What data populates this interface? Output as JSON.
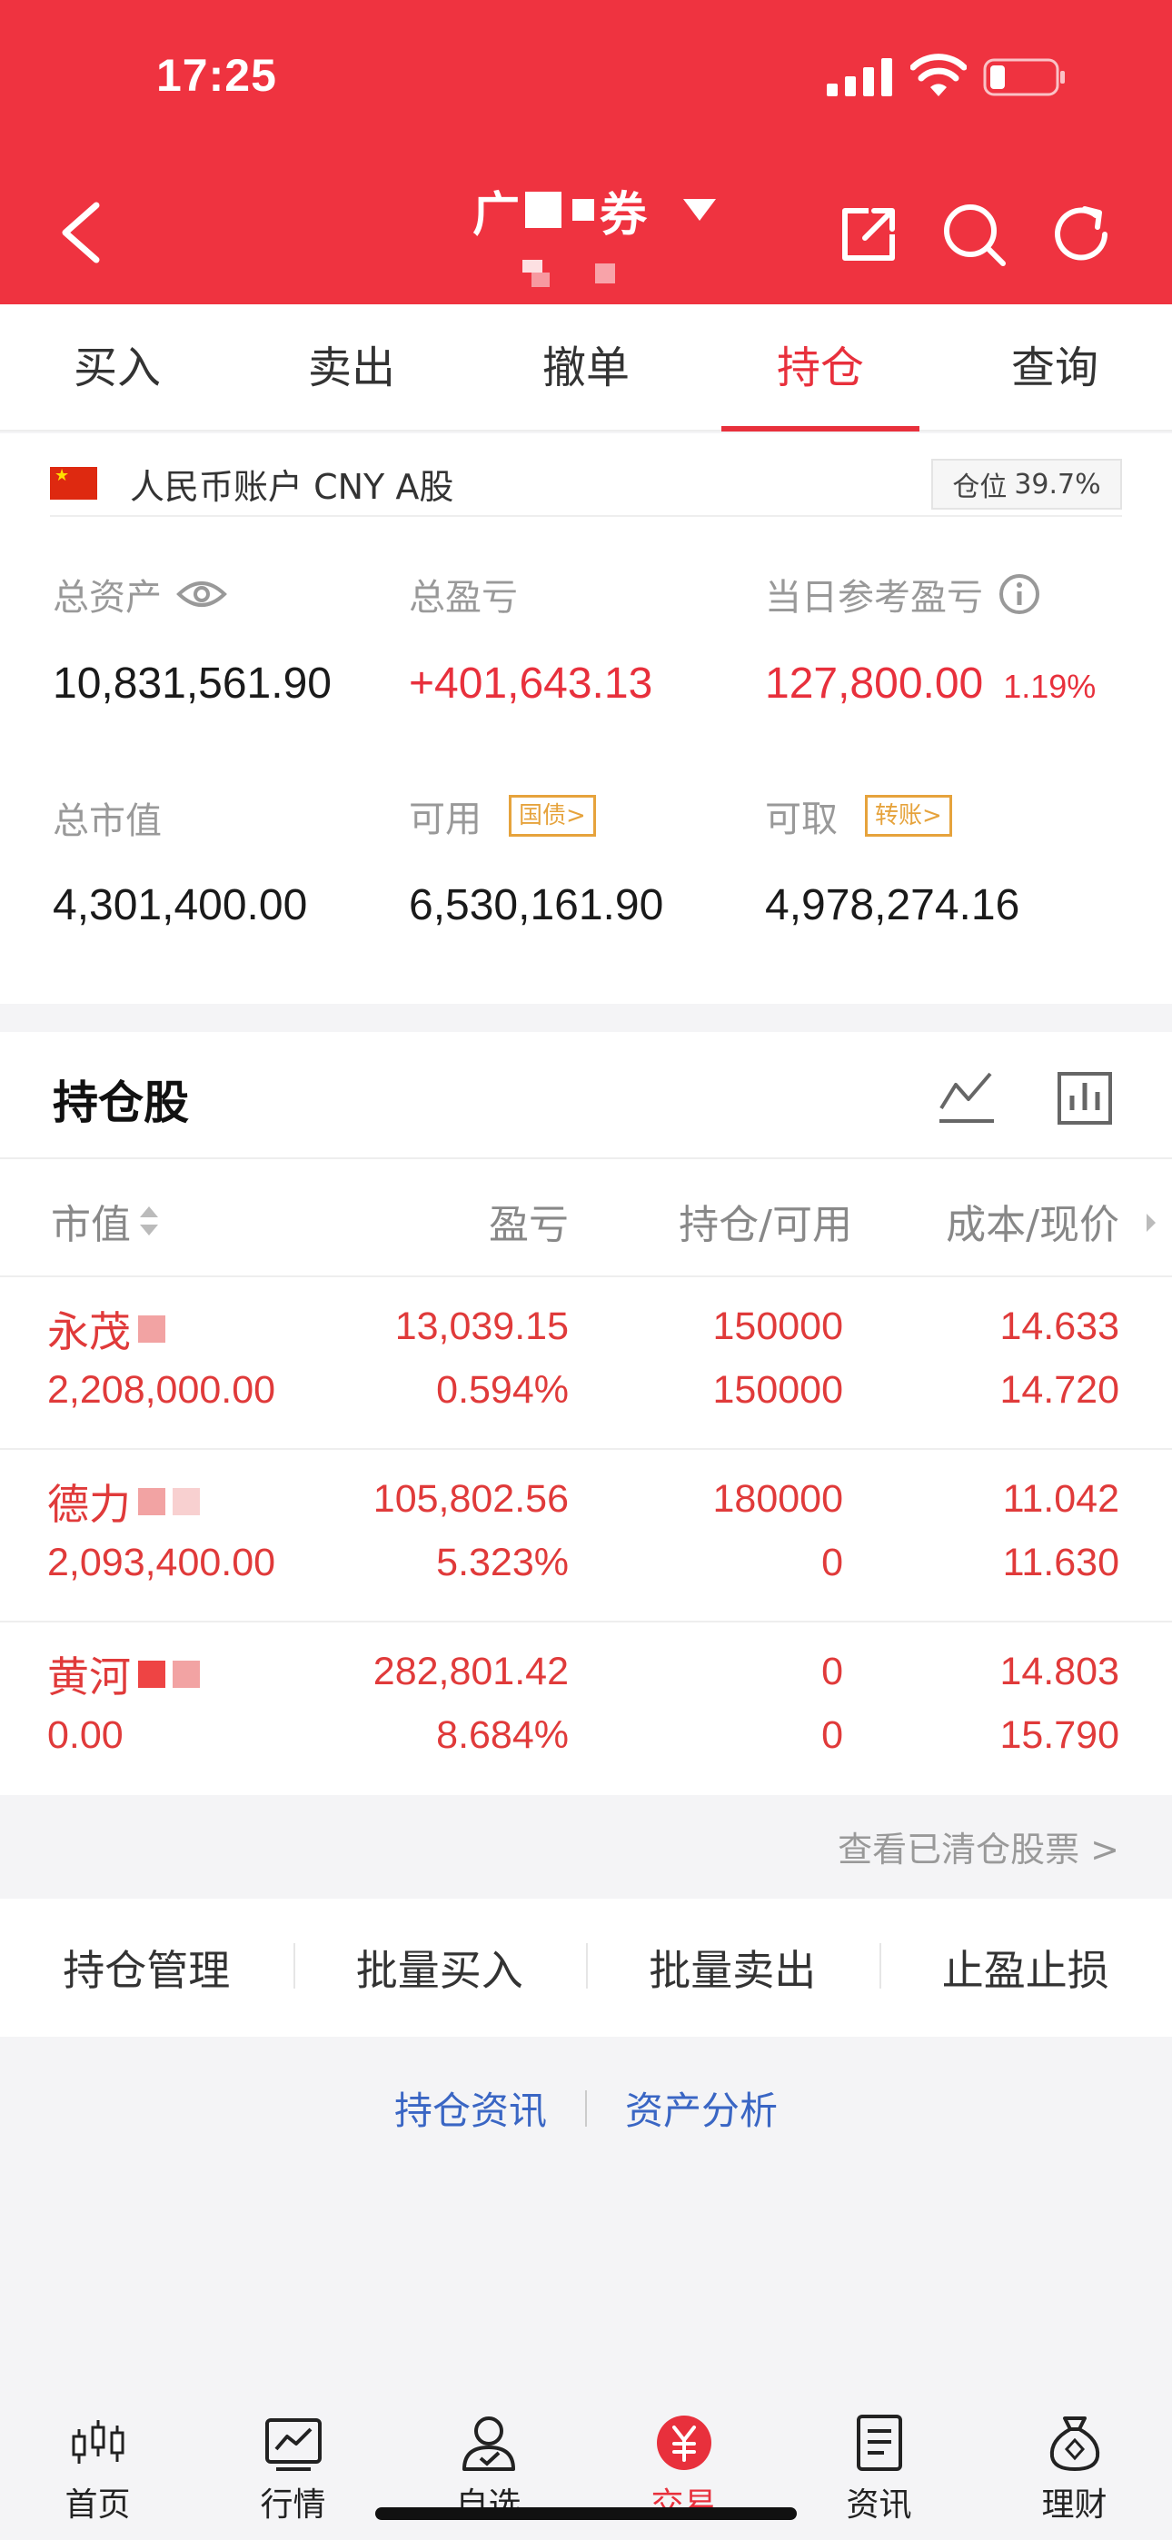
{
  "status_bar": {
    "time": "17:25"
  },
  "header": {
    "title_prefix": "广",
    "title_suffix": "券"
  },
  "tabs": [
    {
      "label": "买入"
    },
    {
      "label": "卖出"
    },
    {
      "label": "撤单"
    },
    {
      "label": "持仓",
      "active": true
    },
    {
      "label": "查询"
    }
  ],
  "account": {
    "name": "人民币账户 CNY A股",
    "position_label": "仓位",
    "position_value": "39.7%",
    "total_assets_label": "总资产",
    "total_assets": "10,831,561.90",
    "total_pl_label": "总盈亏",
    "total_pl": "+401,643.13",
    "daily_pl_label": "当日参考盈亏",
    "daily_pl": "127,800.00",
    "daily_pl_pct": "1.19%",
    "market_value_label": "总市值",
    "market_value": "4,301,400.00",
    "available_label": "可用",
    "available_tag": "国债>",
    "available": "6,530,161.90",
    "withdrawable_label": "可取",
    "withdrawable_tag": "转账>",
    "withdrawable": "4,978,274.16"
  },
  "holdings": {
    "title": "持仓股",
    "columns": {
      "market_value": "市值",
      "pl": "盈亏",
      "qty": "持仓/可用",
      "price": "成本/现价"
    },
    "rows": [
      {
        "name": "永茂",
        "market_value": "2,208,000.00",
        "pl": "13,039.15",
        "pl_pct": "0.594%",
        "qty": "150000",
        "available": "150000",
        "cost": "14.633",
        "price": "14.720"
      },
      {
        "name": "德力",
        "market_value": "2,093,400.00",
        "pl": "105,802.56",
        "pl_pct": "5.323%",
        "qty": "180000",
        "available": "0",
        "cost": "11.042",
        "price": "11.630"
      },
      {
        "name": "黄河",
        "market_value": "0.00",
        "pl": "282,801.42",
        "pl_pct": "8.684%",
        "qty": "0",
        "available": "0",
        "cost": "14.803",
        "price": "15.790"
      }
    ],
    "cleared_link": "查看已清仓股票 >"
  },
  "actions": [
    "持仓管理",
    "批量买入",
    "批量卖出",
    "止盈止损"
  ],
  "links": [
    "持仓资讯",
    "资产分析"
  ],
  "bottom_nav": [
    {
      "label": "首页",
      "icon": "candlestick-icon"
    },
    {
      "label": "行情",
      "icon": "chart-icon"
    },
    {
      "label": "自选",
      "icon": "user-icon"
    },
    {
      "label": "交易",
      "icon": "yuan-icon",
      "active": true
    },
    {
      "label": "资讯",
      "icon": "document-icon"
    },
    {
      "label": "理财",
      "icon": "moneybag-icon"
    }
  ],
  "colors": {
    "brand_red": "#ef3340",
    "link_blue": "#3a66c4",
    "tag_orange": "#e6a33c"
  }
}
